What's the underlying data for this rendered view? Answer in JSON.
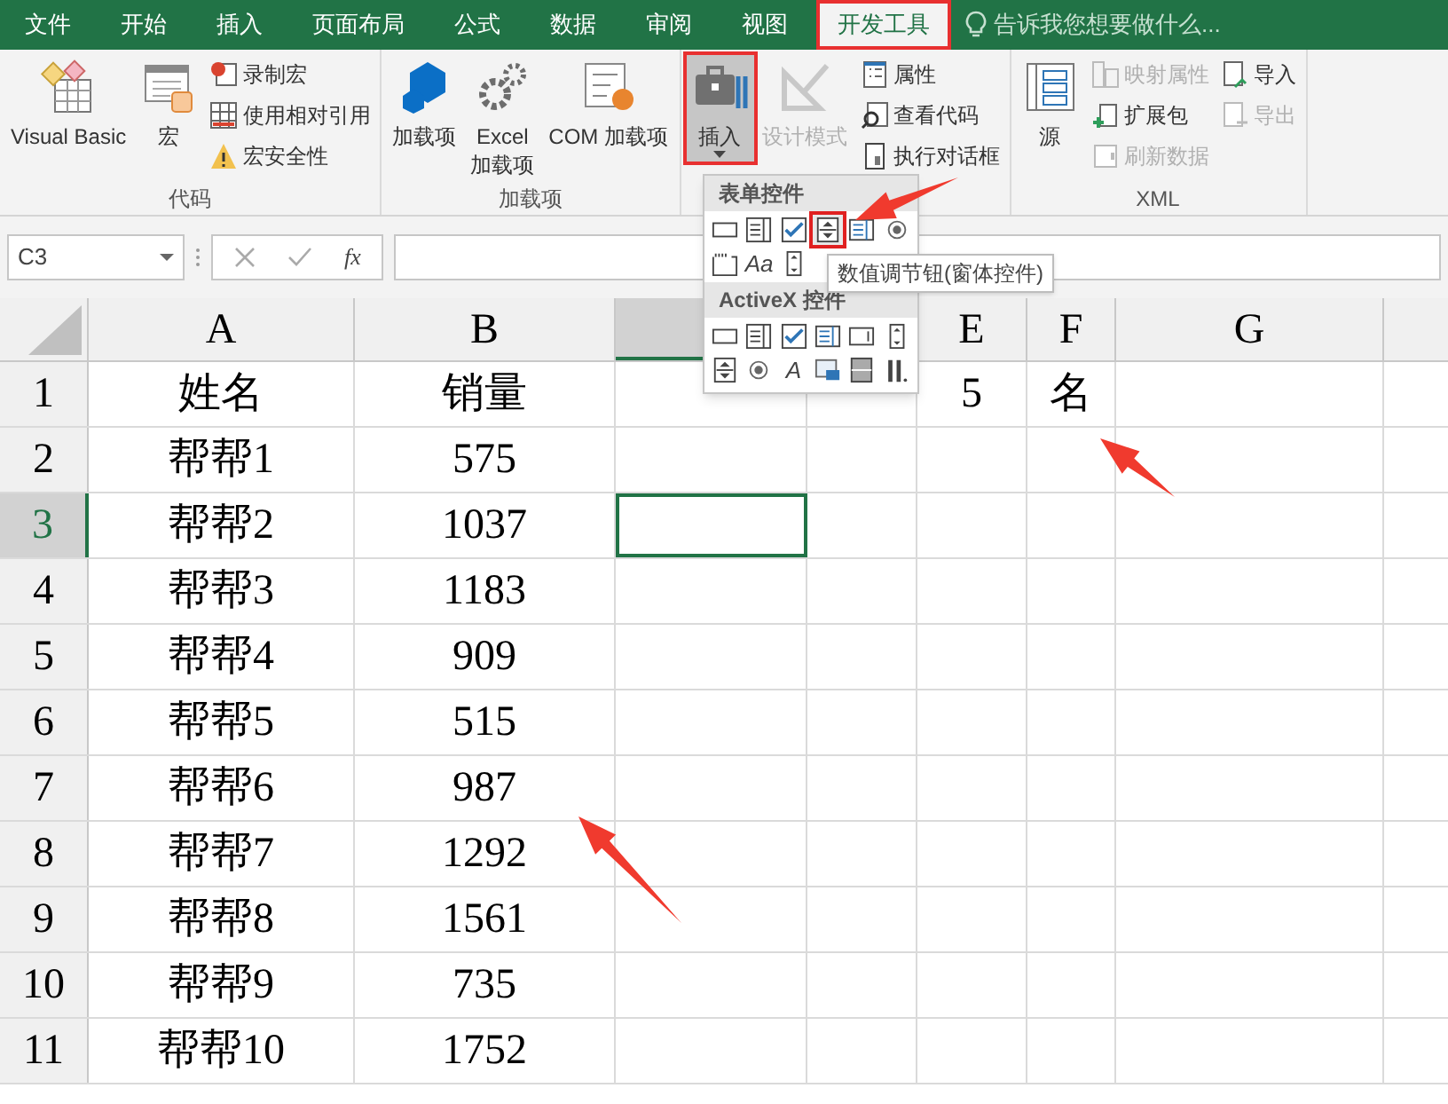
{
  "tabs": [
    {
      "label": "文件",
      "selected": false
    },
    {
      "label": "开始",
      "selected": false
    },
    {
      "label": "插入",
      "selected": false
    },
    {
      "label": "页面布局",
      "selected": false
    },
    {
      "label": "公式",
      "selected": false
    },
    {
      "label": "数据",
      "selected": false
    },
    {
      "label": "审阅",
      "selected": false
    },
    {
      "label": "视图",
      "selected": false
    },
    {
      "label": "开发工具",
      "selected": true,
      "highlighted": true
    }
  ],
  "tell_me": {
    "placeholder": "告诉我您想要做什么..."
  },
  "ribbon": {
    "groups": [
      {
        "label": "代码",
        "large": [
          {
            "label": "Visual Basic",
            "pressed": false,
            "disabled": false
          },
          {
            "label": "宏",
            "pressed": false,
            "disabled": false
          }
        ],
        "small_columns": [
          [
            {
              "label": "录制宏",
              "disabled": false
            },
            {
              "label": "使用相对引用",
              "disabled": false
            },
            {
              "label": "宏安全性",
              "disabled": false
            }
          ]
        ]
      },
      {
        "label": "加载项",
        "large": [
          {
            "label": "加载项",
            "pressed": false,
            "disabled": false
          },
          {
            "label": "Excel\n加载项",
            "pressed": false,
            "disabled": false
          },
          {
            "label": "COM 加载项",
            "pressed": false,
            "disabled": false
          }
        ]
      },
      {
        "large": [
          {
            "label": "插入",
            "pressed": true,
            "highlighted": true,
            "disabled": false
          },
          {
            "label": "设计模式",
            "pressed": false,
            "disabled": true
          }
        ],
        "small_columns": [
          [
            {
              "label": "属性",
              "disabled": false
            },
            {
              "label": "查看代码",
              "disabled": false
            },
            {
              "label": "执行对话框",
              "disabled": false
            }
          ]
        ]
      },
      {
        "label": "XML",
        "large": [
          {
            "label": "源",
            "pressed": false,
            "disabled": false
          }
        ],
        "small_columns": [
          [
            {
              "label": "映射属性",
              "disabled": true
            },
            {
              "label": "扩展包",
              "disabled": false
            },
            {
              "label": "刷新数据",
              "disabled": true
            }
          ],
          [
            {
              "label": "导入",
              "disabled": false
            },
            {
              "label": "导出",
              "disabled": true
            }
          ]
        ]
      }
    ]
  },
  "insert_menu": {
    "sections": [
      {
        "title": "表单控件",
        "controls": [
          {
            "kind": "button"
          },
          {
            "kind": "combo"
          },
          {
            "kind": "check"
          },
          {
            "kind": "spin",
            "highlighted": true
          },
          {
            "kind": "list"
          },
          {
            "kind": "radio"
          },
          {
            "kind": "group"
          },
          {
            "kind": "label",
            "text": "Aa"
          },
          {
            "kind": "scroll"
          }
        ]
      },
      {
        "title": "ActiveX 控件",
        "controls": [
          {
            "kind": "button"
          },
          {
            "kind": "combo"
          },
          {
            "kind": "check"
          },
          {
            "kind": "list"
          },
          {
            "kind": "textbox"
          },
          {
            "kind": "scroll"
          },
          {
            "kind": "spin"
          },
          {
            "kind": "radio"
          },
          {
            "kind": "label",
            "text": "A"
          },
          {
            "kind": "image"
          },
          {
            "kind": "toggle"
          },
          {
            "kind": "more"
          }
        ]
      }
    ],
    "tooltip": "数值调节钮(窗体控件)"
  },
  "formula_bar": {
    "name_box": "C3",
    "fx": "fx"
  },
  "sheet": {
    "columns": [
      {
        "label": "A",
        "selected": false
      },
      {
        "label": "B",
        "selected": false
      },
      {
        "selected": true
      },
      {},
      {
        "label": "E",
        "selected": false
      },
      {
        "label": "F",
        "selected": false
      },
      {
        "label": "G",
        "selected": false
      }
    ],
    "rows": [
      {
        "label": "1",
        "selected": false,
        "cells": [
          "姓名",
          "销量",
          null,
          null,
          "5",
          "名",
          null
        ]
      },
      {
        "label": "2",
        "selected": false,
        "cells": [
          "帮帮1",
          "575",
          null,
          null,
          null,
          null,
          null
        ]
      },
      {
        "label": "3",
        "selected": true,
        "cells": [
          "帮帮2",
          "1037",
          null,
          null,
          null,
          null,
          null
        ]
      },
      {
        "label": "4",
        "selected": false,
        "cells": [
          "帮帮3",
          "1183",
          null,
          null,
          null,
          null,
          null
        ]
      },
      {
        "label": "5",
        "selected": false,
        "cells": [
          "帮帮4",
          "909",
          null,
          null,
          null,
          null,
          null
        ]
      },
      {
        "label": "6",
        "selected": false,
        "cells": [
          "帮帮5",
          "515",
          null,
          null,
          null,
          null,
          null
        ]
      },
      {
        "label": "7",
        "selected": false,
        "cells": [
          "帮帮6",
          "987",
          null,
          null,
          null,
          null,
          null
        ]
      },
      {
        "label": "8",
        "selected": false,
        "cells": [
          "帮帮7",
          "1292",
          null,
          null,
          null,
          null,
          null
        ]
      },
      {
        "label": "9",
        "selected": false,
        "cells": [
          "帮帮8",
          "1561",
          null,
          null,
          null,
          null,
          null
        ]
      },
      {
        "label": "10",
        "selected": false,
        "cells": [
          "帮帮9",
          "735",
          null,
          null,
          null,
          null,
          null
        ]
      },
      {
        "label": "11",
        "selected": false,
        "cells": [
          "帮帮10",
          "1752",
          null,
          null,
          null,
          null,
          null
        ]
      }
    ]
  }
}
